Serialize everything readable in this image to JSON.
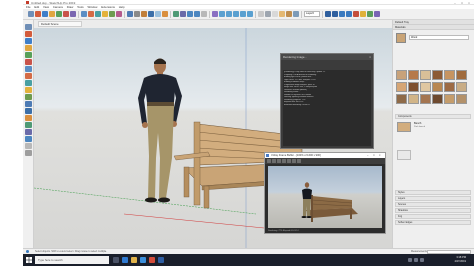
{
  "window": {
    "title": "Untitled.skp - SketchUp Pro 2019"
  },
  "menubar": [
    "File",
    "Edit",
    "View",
    "Camera",
    "Draw",
    "Tools",
    "Window",
    "Extensions",
    "Help"
  ],
  "toolbar": {
    "layer_select": "Layer0",
    "style_select": "Default"
  },
  "scene_tab": {
    "label": "Default Scene"
  },
  "render_log": {
    "title": "Rendering Image...",
    "close_label": "×",
    "lines": [
      "[Rendering] V-Ray Next for SketchUp, update 1.1",
      "Preparing CUDA devices for rendering",
      "Building light cache, please wait...",
      "Light cache: 25.5 MB, Samples: 1524",
      "Building irradiance map...",
      "Progressive image sampler: pass 14",
      "Image size 1600 x 900, 2 samples/pixel",
      "Denoiser: enabled (default)",
      "Rendering frame...",
      "Number of raycasts: 48.2 million",
      "Warning: ignoring invisible material",
      "Rendering progress: 72%",
      "Elapsed time: 00:01:14",
      "Estimated remaining: 00:00:29"
    ]
  },
  "frame_buffer": {
    "title": "V-Ray Frame Buffer - [100% of 1600 x 900]",
    "minimize": "–",
    "maximize": "□",
    "close": "×",
    "status": "Rendering: 72%  Elapsed 00:01:14"
  },
  "tray": {
    "default_tray": "Default Tray",
    "materials_header": "Materials",
    "materials_select": "Wood",
    "components_header": "Components",
    "component_name": "Bench",
    "component_desc": "Park bench",
    "styles_header": "Styles",
    "layers_header": "Layers",
    "scenes_header": "Scenes",
    "shadows_header": "Shadows",
    "fog_header": "Fog",
    "soften_header": "Soften Edges"
  },
  "statusbar": {
    "hint": "Select objects. Shift to extend select. Drag mouse to select multiple.",
    "measurements_label": "Measurements"
  },
  "taskbar": {
    "search_placeholder": "Type here to search",
    "time": "3:18 PM",
    "date": "4/27/2019"
  },
  "colors": {
    "accent_vray": "#4a7cc7",
    "sketchup_red": "#c43d2a",
    "taskbar": "#1a1f2b"
  }
}
